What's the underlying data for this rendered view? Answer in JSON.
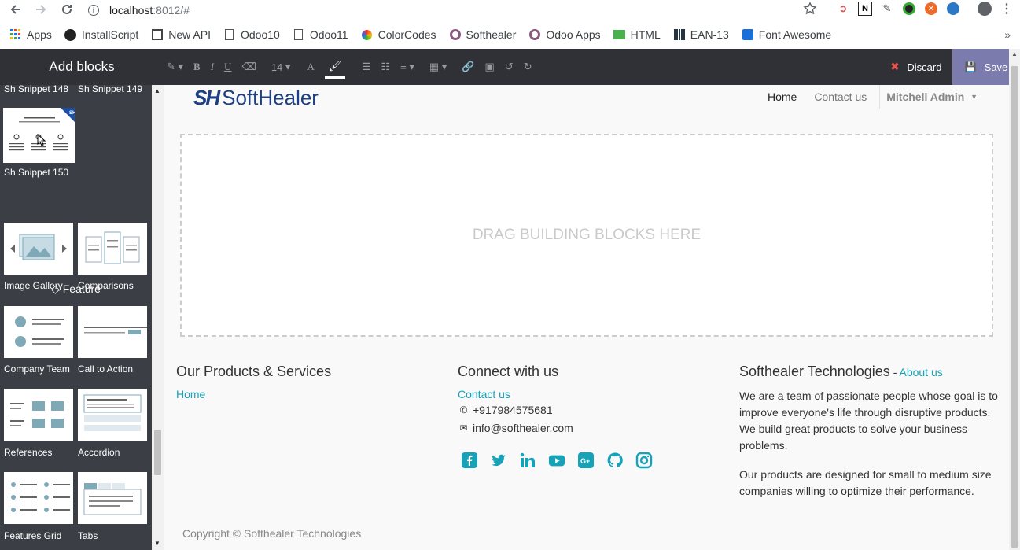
{
  "browser": {
    "url_host": "localhost",
    "url_rest": ":8012/#",
    "bookmarks": [
      {
        "label": "Apps",
        "icon": "apps-grid-icon"
      },
      {
        "label": "InstallScript",
        "icon": "github-icon"
      },
      {
        "label": "New API",
        "icon": "book-icon"
      },
      {
        "label": "Odoo10",
        "icon": "page-icon"
      },
      {
        "label": "Odoo11",
        "icon": "page-icon"
      },
      {
        "label": "ColorCodes",
        "icon": "color-wheel-icon"
      },
      {
        "label": "Softhealer",
        "icon": "circle-icon"
      },
      {
        "label": "Odoo Apps",
        "icon": "circle-icon"
      },
      {
        "label": "HTML",
        "icon": "html-icon"
      },
      {
        "label": "EAN-13",
        "icon": "barcode-icon"
      },
      {
        "label": "Font Awesome",
        "icon": "flag-icon"
      }
    ],
    "more": "»"
  },
  "editor": {
    "side_title": "Add blocks",
    "font_size": "14",
    "discard_label": "Discard",
    "save_label": "Save"
  },
  "snippets": {
    "top_labels": [
      "Sh Snippet 148",
      "Sh Snippet 149"
    ],
    "current_label": "Sh Snippet 150",
    "badge": "SH",
    "feature_heading": "Feature",
    "blocks": [
      {
        "label": "Image Gallery"
      },
      {
        "label": "Comparisons"
      },
      {
        "label": "Company Team"
      },
      {
        "label": "Call to Action"
      },
      {
        "label": "References"
      },
      {
        "label": "Accordion"
      },
      {
        "label": "Features Grid"
      },
      {
        "label": "Tabs"
      }
    ]
  },
  "site": {
    "logo_mark": "SH",
    "logo_word": "SoftHealer",
    "nav": {
      "home": "Home",
      "contact": "Contact us",
      "user": "Mitchell Admin"
    },
    "dropzone_text": "DRAG BUILDING BLOCKS HERE",
    "footer": {
      "col1_title": "Our Products & Services",
      "col1_links": [
        "Home"
      ],
      "col2_title": "Connect with us",
      "col2_link": "Contact us",
      "phone": "+917984575681",
      "email": "info@softhealer.com",
      "col3_title": "Softhealer Technologies",
      "col3_dash": " - ",
      "col3_link": "About us",
      "col3_p1": "We are a team of passionate people whose goal is to improve everyone's life through disruptive products. We build great products to solve your business problems.",
      "col3_p2": "Our products are designed for small to medium size companies willing to optimize their performance.",
      "copyright": "Copyright © Softhealer Technologies"
    },
    "accent_color": "#17a2b8"
  }
}
